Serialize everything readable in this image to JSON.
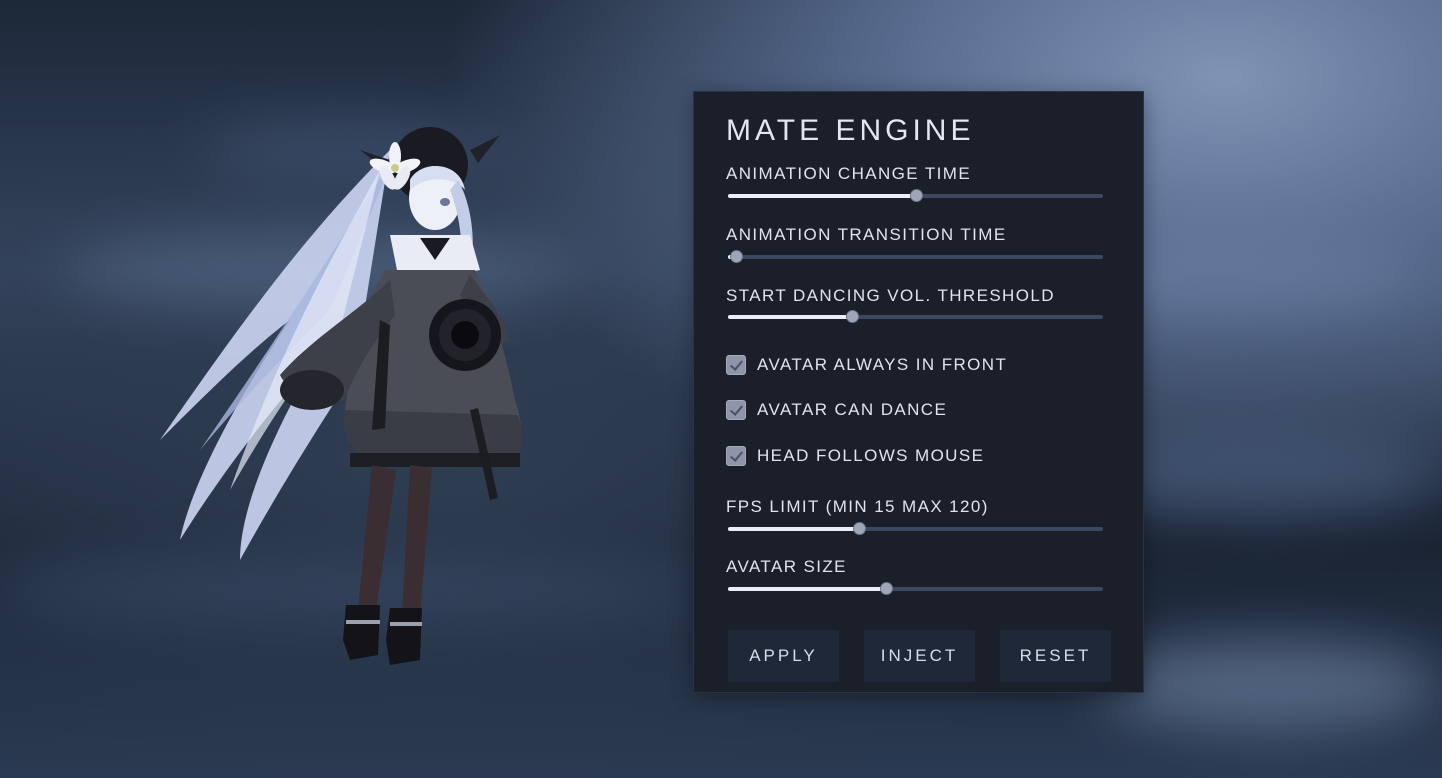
{
  "panel": {
    "title": "MATE ENGINE",
    "sliders": [
      {
        "label": "ANIMATION CHANGE TIME",
        "value": 0.5
      },
      {
        "label": "ANIMATION TRANSITION TIME",
        "value": 0.02
      },
      {
        "label": "START DANCING VOL. THRESHOLD",
        "value": 0.33
      },
      {
        "label": "FPS LIMIT (MIN 15 MAX 120)",
        "value": 0.35
      },
      {
        "label": "AVATAR SIZE",
        "value": 0.42
      }
    ],
    "checkboxes": [
      {
        "label": "AVATAR ALWAYS IN FRONT",
        "checked": true
      },
      {
        "label": "AVATAR CAN DANCE",
        "checked": true
      },
      {
        "label": "HEAD FOLLOWS MOUSE",
        "checked": true
      }
    ],
    "buttons": {
      "apply": "APPLY",
      "inject": "INJECT",
      "reset": "RESET"
    }
  },
  "colors": {
    "panel_bg": "#1b1f29",
    "slider_fill": "#ecedf6",
    "slider_track": "#3c4860",
    "button_bg": "#1f2838",
    "text": "#e1e4f0"
  }
}
